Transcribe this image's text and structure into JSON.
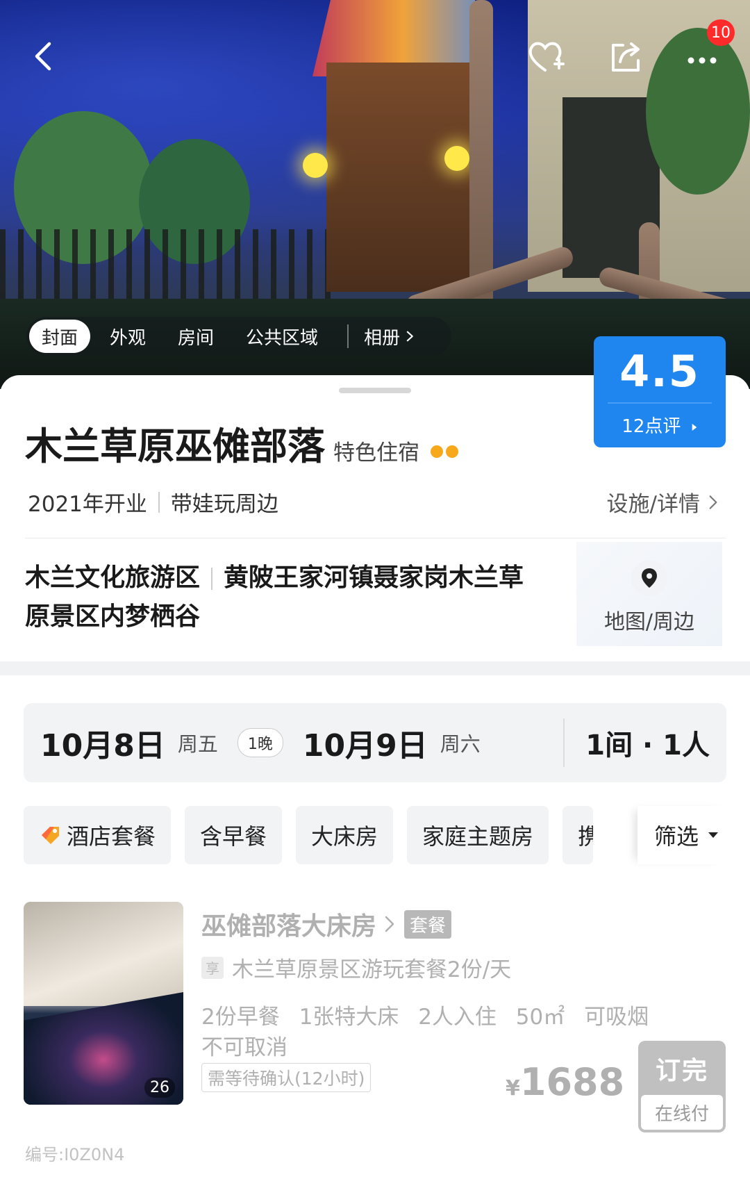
{
  "topbar": {
    "back_icon": "chevron-left-icon",
    "favorite_icon": "heart-plus-icon",
    "share_icon": "share-icon",
    "more_icon": "more-dots-icon",
    "notification_count": "10"
  },
  "gallery": {
    "tabs": [
      {
        "label": "封面",
        "active": true
      },
      {
        "label": "外观",
        "active": false
      },
      {
        "label": "房间",
        "active": false
      },
      {
        "label": "公共区域",
        "active": false
      }
    ],
    "album_label": "相册"
  },
  "rating": {
    "score": "4.5",
    "reviews_label": "12点评"
  },
  "hotel": {
    "name": "木兰草原巫傩部落",
    "type": "特色住宿",
    "opened": "2021年开业",
    "tag": "带娃玩周边",
    "details_link": "设施/详情",
    "area": "木兰文化旅游区",
    "address": "黄陂王家河镇聂家岗木兰草原景区内梦栖谷",
    "map_label": "地图/周边"
  },
  "booking": {
    "checkin_date": "10月8日",
    "checkin_weekday": "周五",
    "nights": "1晚",
    "checkout_date": "10月9日",
    "checkout_weekday": "周六",
    "guests": "1间 · 1人"
  },
  "filters": {
    "chips": [
      "酒店套餐",
      "含早餐",
      "大床房",
      "家庭主题房",
      "携"
    ],
    "filter_label": "筛选"
  },
  "room": {
    "name": "巫傩部落大床房",
    "package_badge": "套餐",
    "enjoy_icon_label": "享",
    "package_desc": "木兰草原景区游玩套餐2份/天",
    "specs": [
      "2份早餐",
      "1张特大床",
      "2人入住",
      "50㎡",
      "可吸烟"
    ],
    "cancel_policy": "不可取消",
    "confirm_note": "需等待确认(12小时)",
    "photo_count": "26",
    "currency": "¥",
    "price": "1688",
    "book_label": "订完",
    "pay_label": "在线付",
    "code": "编号:I0Z0N4"
  },
  "colors": {
    "accent_blue": "#1f86f0",
    "badge_red": "#ff2a2a",
    "dot_orange": "#f7a81b",
    "sold_out_gray": "#c0c0c0"
  }
}
